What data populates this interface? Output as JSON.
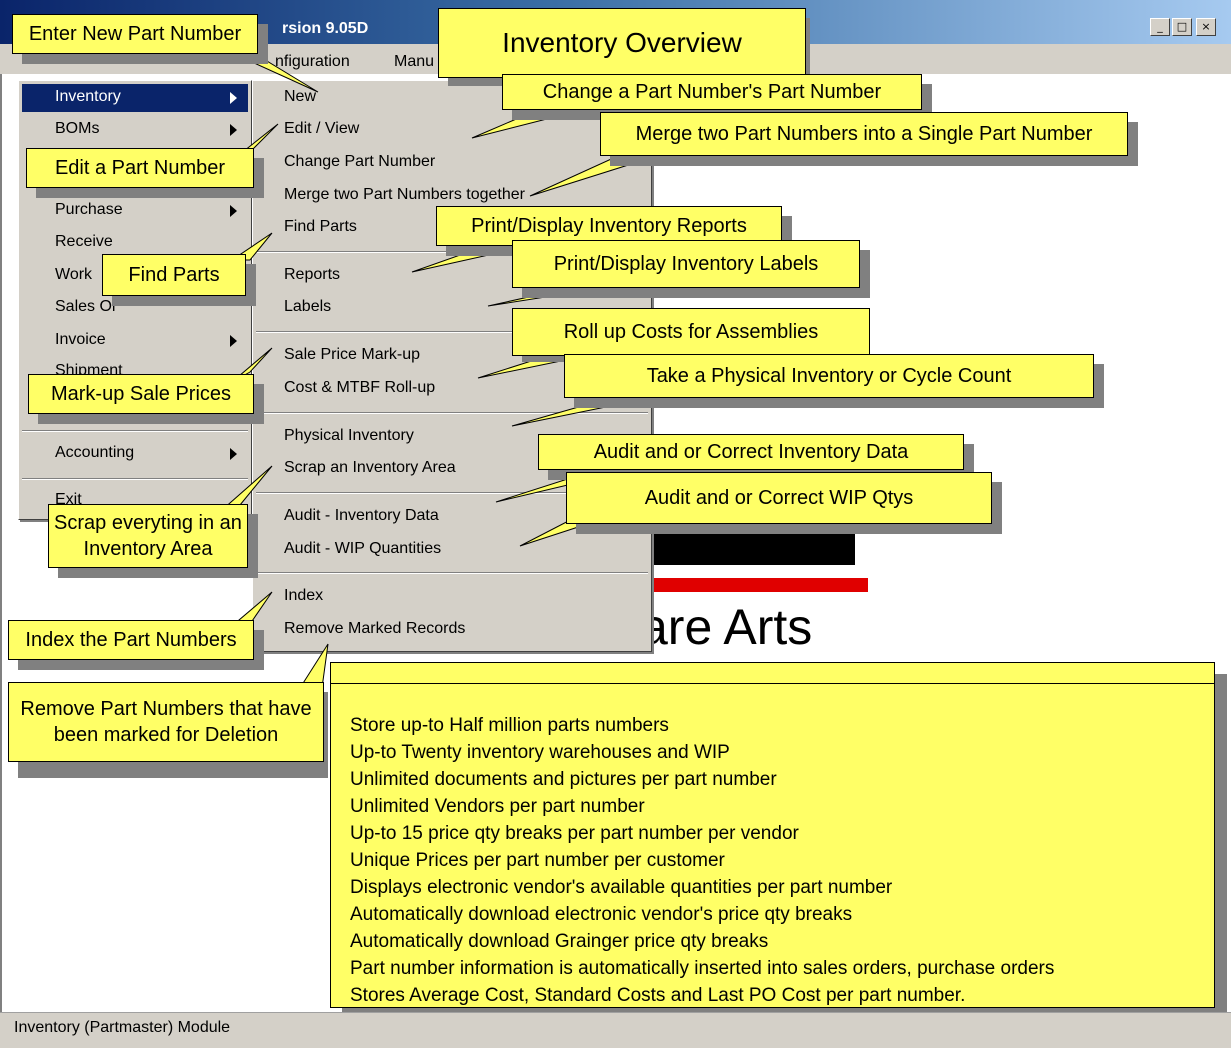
{
  "window": {
    "title": "rsion 9.05D",
    "minimize": "_",
    "maximize": "□",
    "close": "×"
  },
  "menubar": [
    "nfiguration",
    "Manu"
  ],
  "main_menu": {
    "items": [
      {
        "label": "Inventory",
        "selected": true,
        "submenu": true
      },
      {
        "label": "BOMs",
        "submenu": true
      },
      {
        "label": "Purchase",
        "submenu": true
      },
      {
        "label": "Receive"
      },
      {
        "label": "Work"
      },
      {
        "label": "Sales Or"
      },
      {
        "label": "Invoice",
        "submenu": true
      },
      {
        "label": "Shipment"
      },
      {
        "label": "Accounting",
        "submenu": true
      },
      {
        "label": "Exit"
      }
    ]
  },
  "sub_menu": {
    "items": [
      "New",
      "Edit / View",
      "Change Part Number",
      "Merge two Part Numbers together",
      "Find Parts",
      "Reports",
      "Labels",
      "Sale Price Mark-up",
      "Cost & MTBF Roll-up",
      "Physical Inventory",
      "Scrap an Inventory Area",
      "Audit - Inventory Data",
      "Audit - WIP Quantities",
      "Index",
      "Remove Marked Records"
    ]
  },
  "callouts": {
    "title": "Inventory Overview",
    "new": "Enter New Part Number",
    "edit": "Edit a Part Number",
    "find": "Find Parts",
    "markup": "Mark-up Sale Prices",
    "scrap": "Scrap everyting in an Inventory Area",
    "index": "Index the Part Numbers",
    "remove": "Remove Part Numbers that have been marked for Deletion",
    "change": "Change a Part Number's Part Number",
    "merge": "Merge two Part Numbers into a Single Part Number",
    "reports": "Print/Display Inventory Reports",
    "labels": "Print/Display Inventory Labels",
    "rollup": "Roll up Costs for Assemblies",
    "physical": "Take a Physical Inventory or Cycle Count",
    "audit": "Audit and or Correct Inventory Data",
    "wip": "Audit and or Correct WIP Qtys"
  },
  "features": [
    "Store up-to Half million parts numbers",
    "Up-to Twenty inventory warehouses and WIP",
    "Unlimited documents and pictures per part number",
    "Unlimited Vendors per part number",
    "Up-to 15 price qty breaks per part number per vendor",
    "Unique Prices per part number per customer",
    "Displays electronic vendor's available quantities per part number",
    "Automatically download electronic vendor's price qty breaks",
    "Automatically download Grainger price qty breaks",
    "Part number information is automatically inserted into sales orders, purchase orders",
    "Stores Average Cost, Standard Costs and Last PO Cost per part number."
  ],
  "logo": {
    "text": "are Arts"
  },
  "status": {
    "text": "Inventory (Partmaster) Module"
  },
  "colors": {
    "callout": "#ffff66",
    "highlight": "#0a246a",
    "menu": "#d4d0c8"
  }
}
